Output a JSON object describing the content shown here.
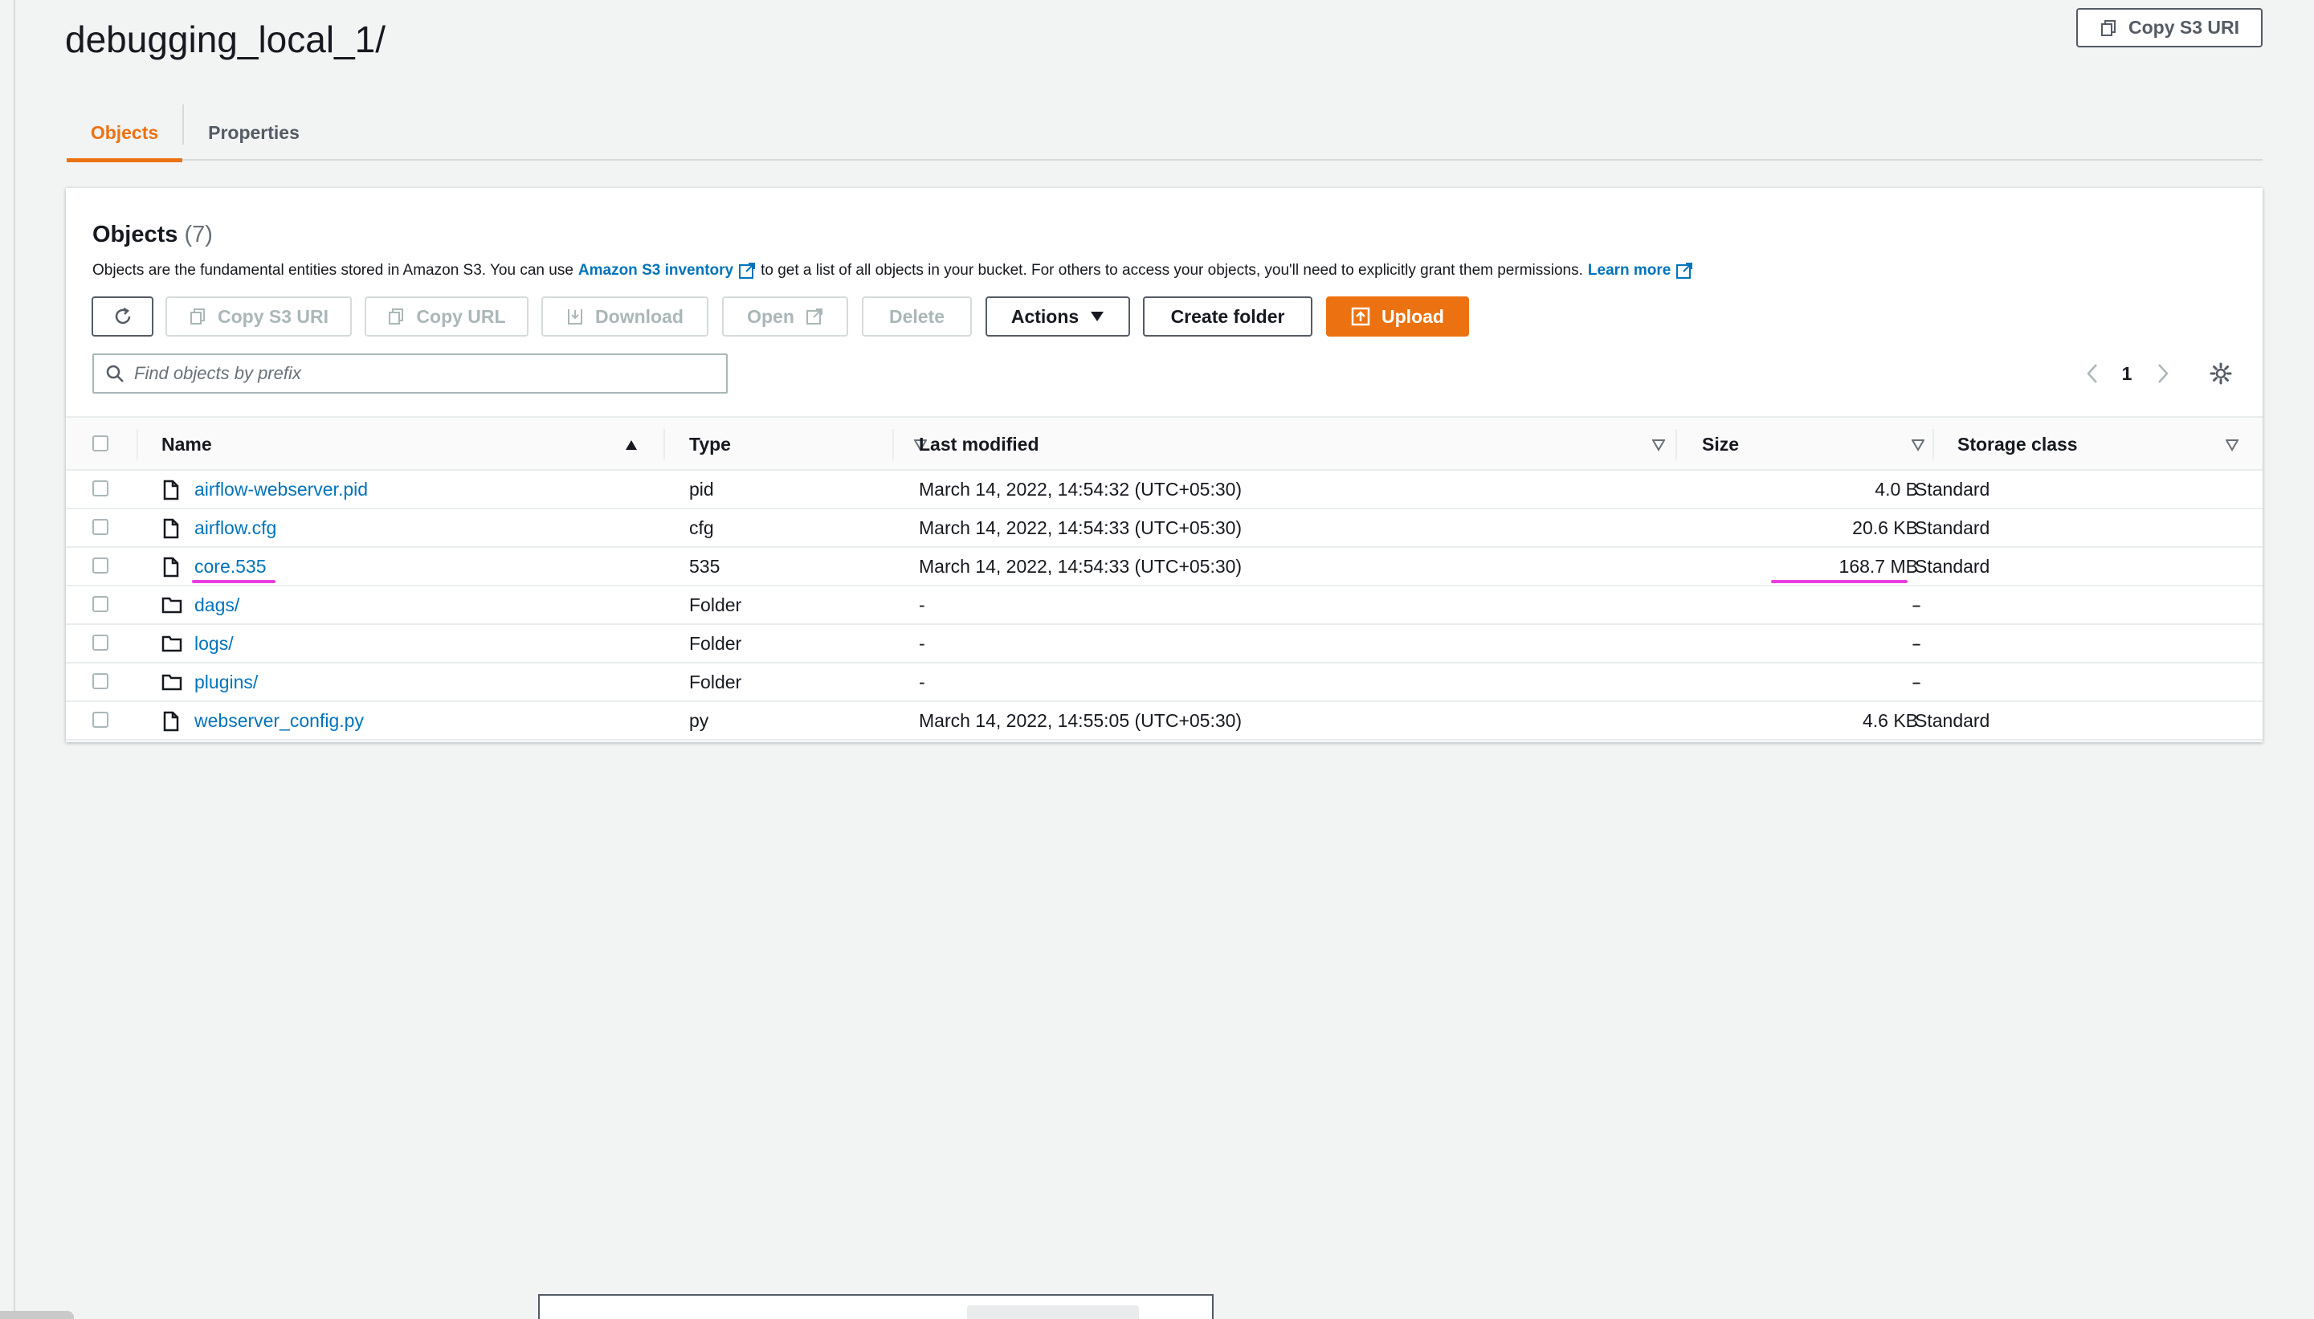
{
  "page": {
    "title": "debugging_local_1/",
    "copy_s3_uri": "Copy S3 URI"
  },
  "tabs": [
    {
      "label": "Objects",
      "active": true
    },
    {
      "label": "Properties",
      "active": false
    }
  ],
  "panel": {
    "title": "Objects",
    "count": "(7)",
    "desc_1": "Objects are the fundamental entities stored in Amazon S3. You can use",
    "link_inventory": "Amazon S3 inventory",
    "desc_2": "to get a list of all objects in your bucket. For others to access your objects, you'll need to explicitly grant them permissions.",
    "link_learn": "Learn more"
  },
  "toolbar": {
    "copy_s3_uri": "Copy S3 URI",
    "copy_url": "Copy URL",
    "download": "Download",
    "open": "Open",
    "delete": "Delete",
    "actions": "Actions",
    "create_folder": "Create folder",
    "upload": "Upload"
  },
  "search": {
    "placeholder": "Find objects by prefix"
  },
  "pagination": {
    "page": "1"
  },
  "columns": {
    "name": "Name",
    "type": "Type",
    "last_modified": "Last modified",
    "size": "Size",
    "storage_class": "Storage class"
  },
  "rows": [
    {
      "name": "airflow-webserver.pid",
      "kind": "file",
      "type": "pid",
      "last_modified": "March 14, 2022, 14:54:32 (UTC+05:30)",
      "size": "4.0 B",
      "storage_class": "Standard"
    },
    {
      "name": "airflow.cfg",
      "kind": "file",
      "type": "cfg",
      "last_modified": "March 14, 2022, 14:54:33 (UTC+05:30)",
      "size": "20.6 KB",
      "storage_class": "Standard"
    },
    {
      "name": "core.535",
      "kind": "file",
      "type": "535",
      "last_modified": "March 14, 2022, 14:54:33 (UTC+05:30)",
      "size": "168.7 MB",
      "storage_class": "Standard"
    },
    {
      "name": "dags/",
      "kind": "folder",
      "type": "Folder",
      "last_modified": "-",
      "size": "-",
      "storage_class": "-"
    },
    {
      "name": "logs/",
      "kind": "folder",
      "type": "Folder",
      "last_modified": "-",
      "size": "-",
      "storage_class": "-"
    },
    {
      "name": "plugins/",
      "kind": "folder",
      "type": "Folder",
      "last_modified": "-",
      "size": "-",
      "storage_class": "-"
    },
    {
      "name": "webserver_config.py",
      "kind": "file",
      "type": "py",
      "last_modified": "March 14, 2022, 14:55:05 (UTC+05:30)",
      "size": "4.6 KB",
      "storage_class": "Standard"
    }
  ],
  "colors": {
    "accent": "#ec7211",
    "link": "#0073bb",
    "highlight": "#e83ee0"
  }
}
